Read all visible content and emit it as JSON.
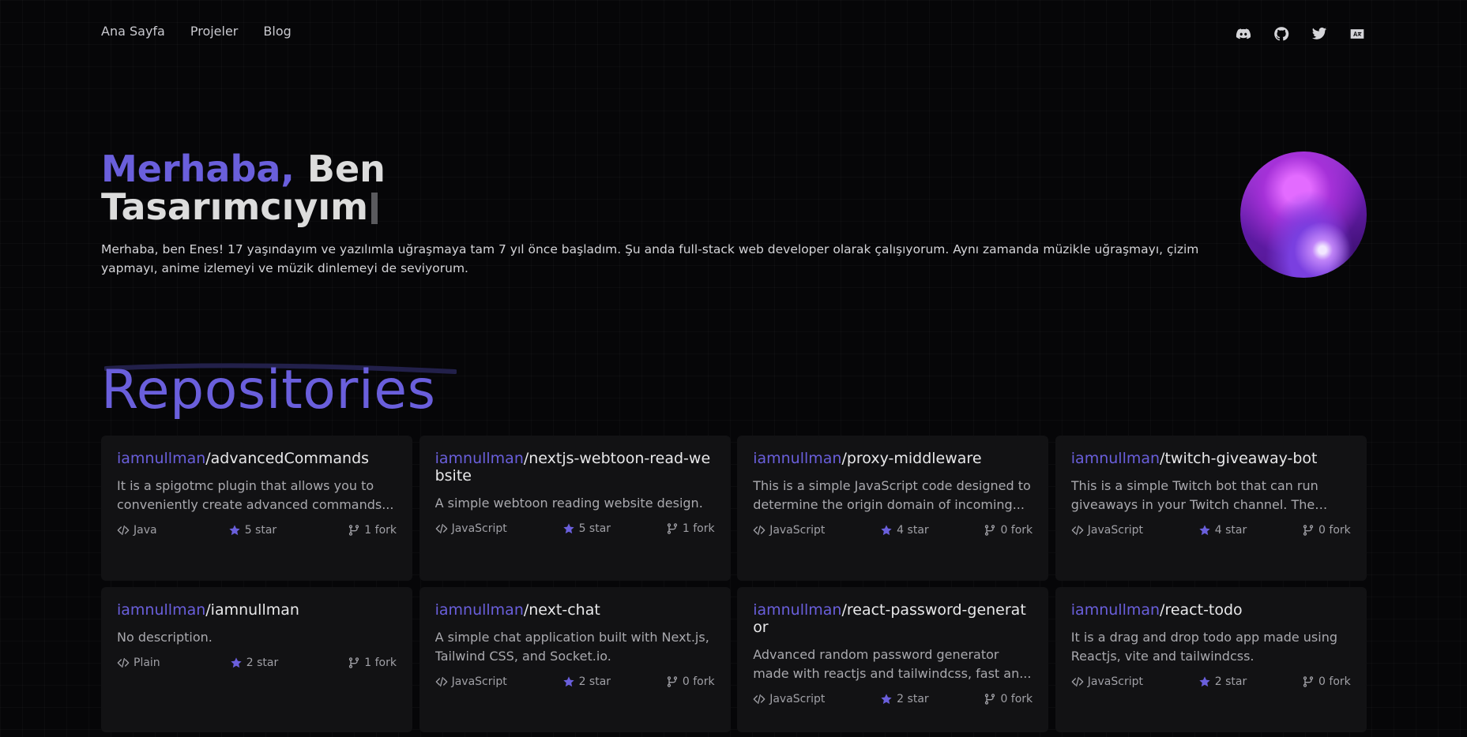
{
  "nav": {
    "items": [
      {
        "label": "Ana Sayfa"
      },
      {
        "label": "Projeler"
      },
      {
        "label": "Blog"
      }
    ],
    "social_icons": [
      "discord-icon",
      "github-icon",
      "twitter-icon",
      "translate-icon"
    ]
  },
  "hero": {
    "greeting": "Merhaba,",
    "title_rest": " Ben",
    "title_line2": "Tasarımcıyım",
    "description": "Merhaba, ben Enes! 17 yaşındayım ve yazılımla uğraşmaya tam 7 yıl önce başladım. Şu anda full-stack web developer olarak çalışıyorum. Aynı zamanda müzikle uğraşmayı, çizim yapmayı, anime izlemeyi ve müzik dinlemeyi de seviyorum."
  },
  "repos": {
    "heading": "Repositories",
    "items": [
      {
        "owner": "iamnullman",
        "repo": "/advancedCommands",
        "description": "It is a spigotmc plugin that allows you to conveniently create advanced commands...",
        "language": "Java",
        "stars": "5 star",
        "forks": "1 fork"
      },
      {
        "owner": "iamnullman",
        "repo": "/nextjs-webtoon-read-website",
        "description": "A simple webtoon reading website design.",
        "language": "JavaScript",
        "stars": "5 star",
        "forks": "1 fork"
      },
      {
        "owner": "iamnullman",
        "repo": "/proxy-middleware",
        "description": "This is a simple JavaScript code designed to determine the origin domain of incoming...",
        "language": "JavaScript",
        "stars": "4 star",
        "forks": "0 fork"
      },
      {
        "owner": "iamnullman",
        "repo": "/twitch-giveaway-bot",
        "description": "This is a simple Twitch bot that can run giveaways in your Twitch channel. The bot...",
        "language": "JavaScript",
        "stars": "4 star",
        "forks": "0 fork"
      },
      {
        "owner": "iamnullman",
        "repo": "/iamnullman",
        "description": "No description.",
        "language": "Plain",
        "stars": "2 star",
        "forks": "1 fork"
      },
      {
        "owner": "iamnullman",
        "repo": "/next-chat",
        "description": "A simple chat application built with Next.js, Tailwind CSS, and Socket.io.",
        "language": "JavaScript",
        "stars": "2 star",
        "forks": "0 fork"
      },
      {
        "owner": "iamnullman",
        "repo": "/react-password-generator",
        "description": "Advanced random password generator made with reactjs and tailwindcss, fast an...",
        "language": "JavaScript",
        "stars": "2 star",
        "forks": "0 fork"
      },
      {
        "owner": "iamnullman",
        "repo": "/react-todo",
        "description": "It is a drag and drop todo app made using Reactjs, vite and tailwindcss.",
        "language": "JavaScript",
        "stars": "2 star",
        "forks": "0 fork"
      }
    ]
  },
  "colors": {
    "accent": "#6a5fdc",
    "background": "#060608",
    "card": "#121214"
  }
}
